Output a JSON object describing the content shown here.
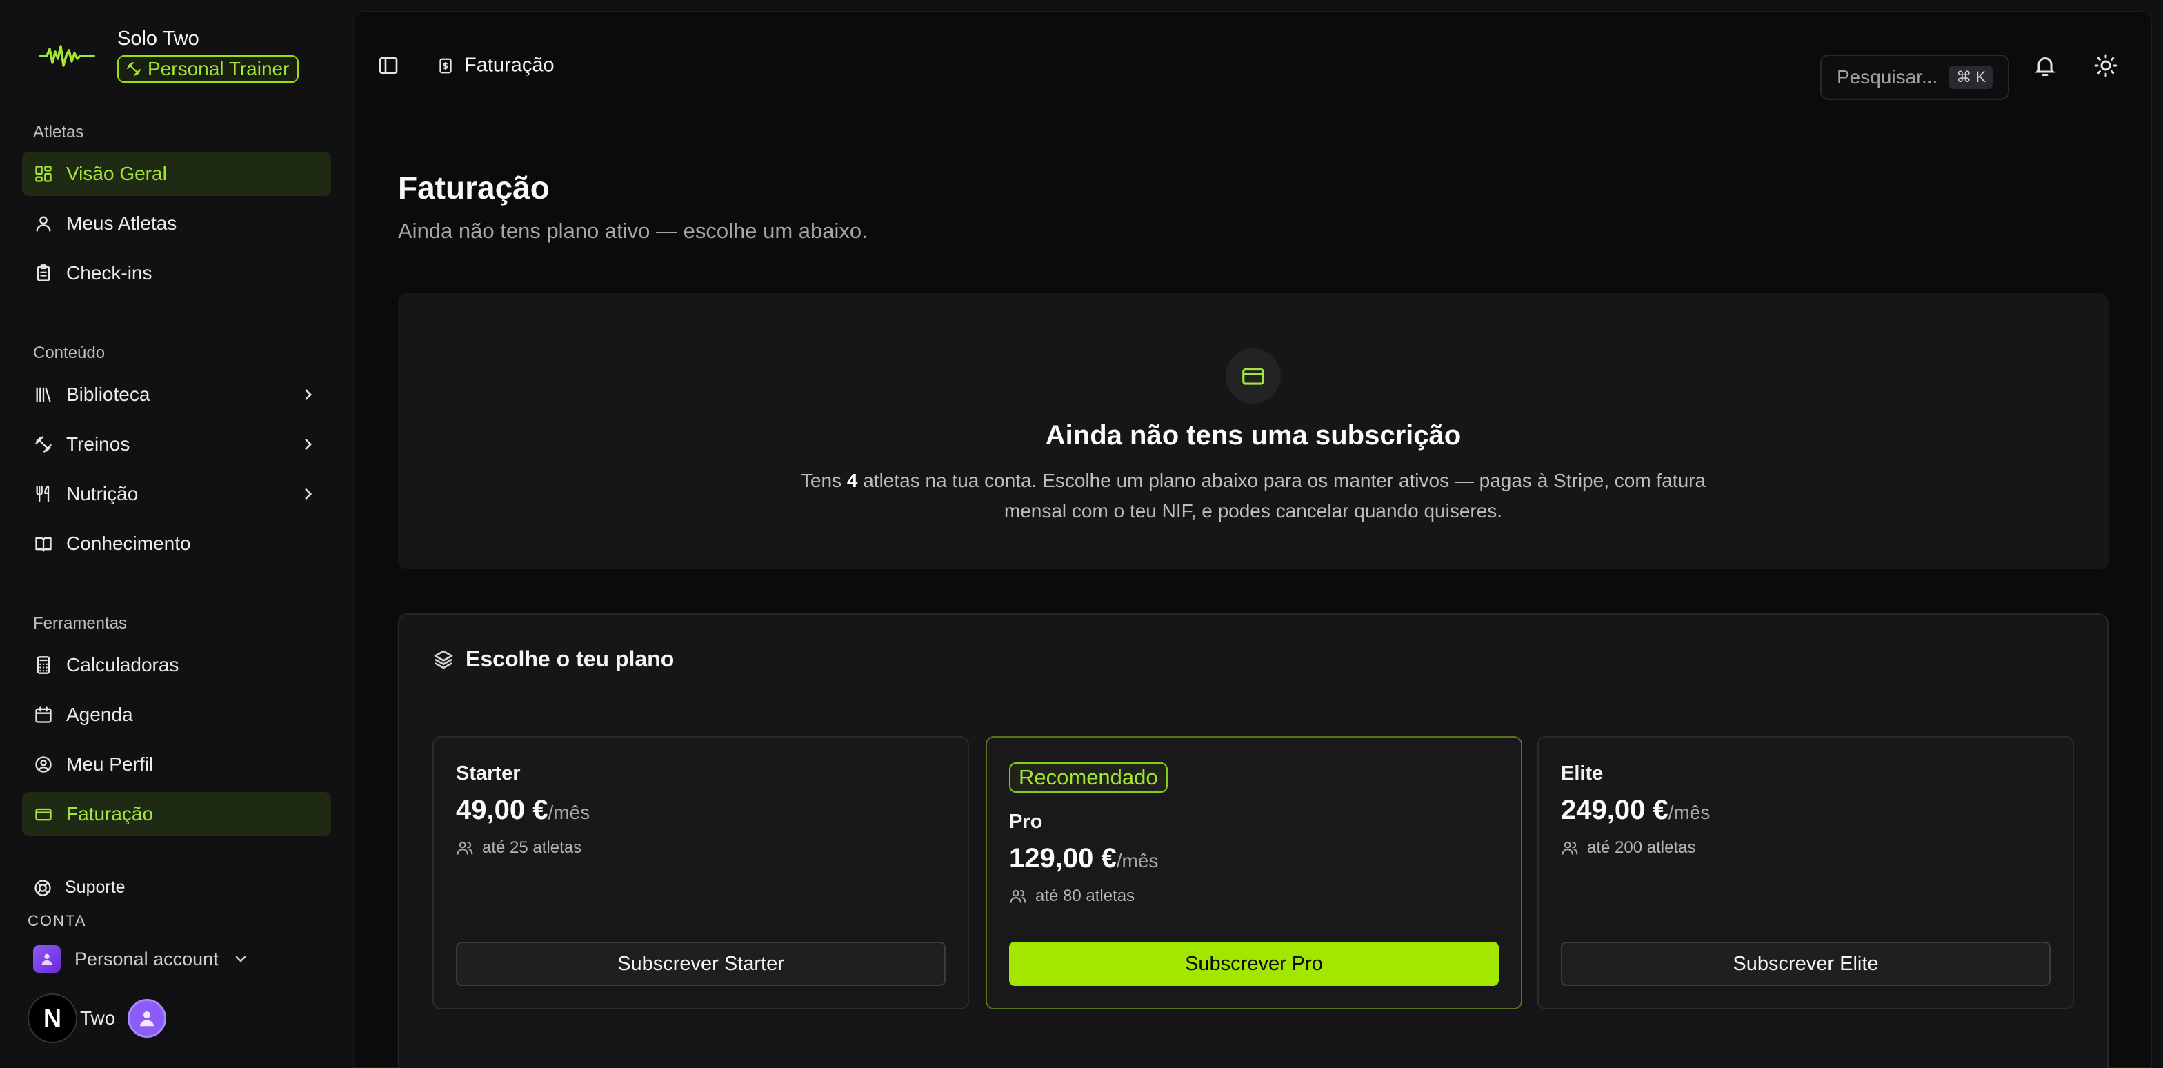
{
  "brand": {
    "name": "Solo Two",
    "role": "Personal Trainer"
  },
  "sidebar": {
    "sections": [
      {
        "heading": "Atletas",
        "items": [
          {
            "label": "Visão Geral",
            "icon": "dashboard-icon",
            "active": true,
            "chevron": false
          },
          {
            "label": "Meus Atletas",
            "icon": "user-icon",
            "active": false,
            "chevron": false
          },
          {
            "label": "Check-ins",
            "icon": "clipboard-icon",
            "active": false,
            "chevron": false
          }
        ]
      },
      {
        "heading": "Conteúdo",
        "items": [
          {
            "label": "Biblioteca",
            "icon": "library-icon",
            "active": false,
            "chevron": true
          },
          {
            "label": "Treinos",
            "icon": "dumbbell-icon",
            "active": false,
            "chevron": true
          },
          {
            "label": "Nutrição",
            "icon": "utensils-icon",
            "active": false,
            "chevron": true
          },
          {
            "label": "Conhecimento",
            "icon": "book-icon",
            "active": false,
            "chevron": false
          }
        ]
      },
      {
        "heading": "Ferramentas",
        "items": [
          {
            "label": "Calculadoras",
            "icon": "calculator-icon",
            "active": false,
            "chevron": false
          },
          {
            "label": "Agenda",
            "icon": "calendar-icon",
            "active": false,
            "chevron": false
          },
          {
            "label": "Meu Perfil",
            "icon": "user-circle-icon",
            "active": false,
            "chevron": false
          },
          {
            "label": "Faturação",
            "icon": "credit-card-icon",
            "active": true,
            "chevron": false
          }
        ]
      }
    ],
    "support_label": "Suporte",
    "account_heading": "CONTA",
    "account_label": "Personal account",
    "user_initial": "N",
    "user_name": "Two"
  },
  "topbar": {
    "breadcrumb": "Faturação",
    "search_placeholder": "Pesquisar...",
    "search_shortcut": "⌘ K"
  },
  "page": {
    "title": "Faturação",
    "subtitle": "Ainda não tens plano ativo — escolhe um abaixo."
  },
  "empty_state": {
    "title": "Ainda não tens uma subscrição",
    "text_before": "Tens ",
    "athlete_count": "4",
    "text_after": " atletas na tua conta. Escolhe um plano abaixo para os manter ativos — pagas à Stripe, com fatura mensal com o teu NIF, e podes cancelar quando quiseres."
  },
  "plans": {
    "heading": "Escolhe o teu plano",
    "items": [
      {
        "badge": "",
        "name": "Starter",
        "price": "49,00 €",
        "period": "/mês",
        "limit": "até 25 atletas",
        "button": "Subscrever Starter",
        "featured": false
      },
      {
        "badge": "Recomendado",
        "name": "Pro",
        "price": "129,00 €",
        "period": "/mês",
        "limit": "até 80 atletas",
        "button": "Subscrever Pro",
        "featured": true
      },
      {
        "badge": "",
        "name": "Elite",
        "price": "249,00 €",
        "period": "/mês",
        "limit": "até 200 atletas",
        "button": "Subscrever Elite",
        "featured": false
      }
    ]
  },
  "colors": {
    "accent": "#a3e635",
    "accent_button": "#a3e600",
    "background": "#0b0b0c",
    "sidebar": "#111113"
  }
}
